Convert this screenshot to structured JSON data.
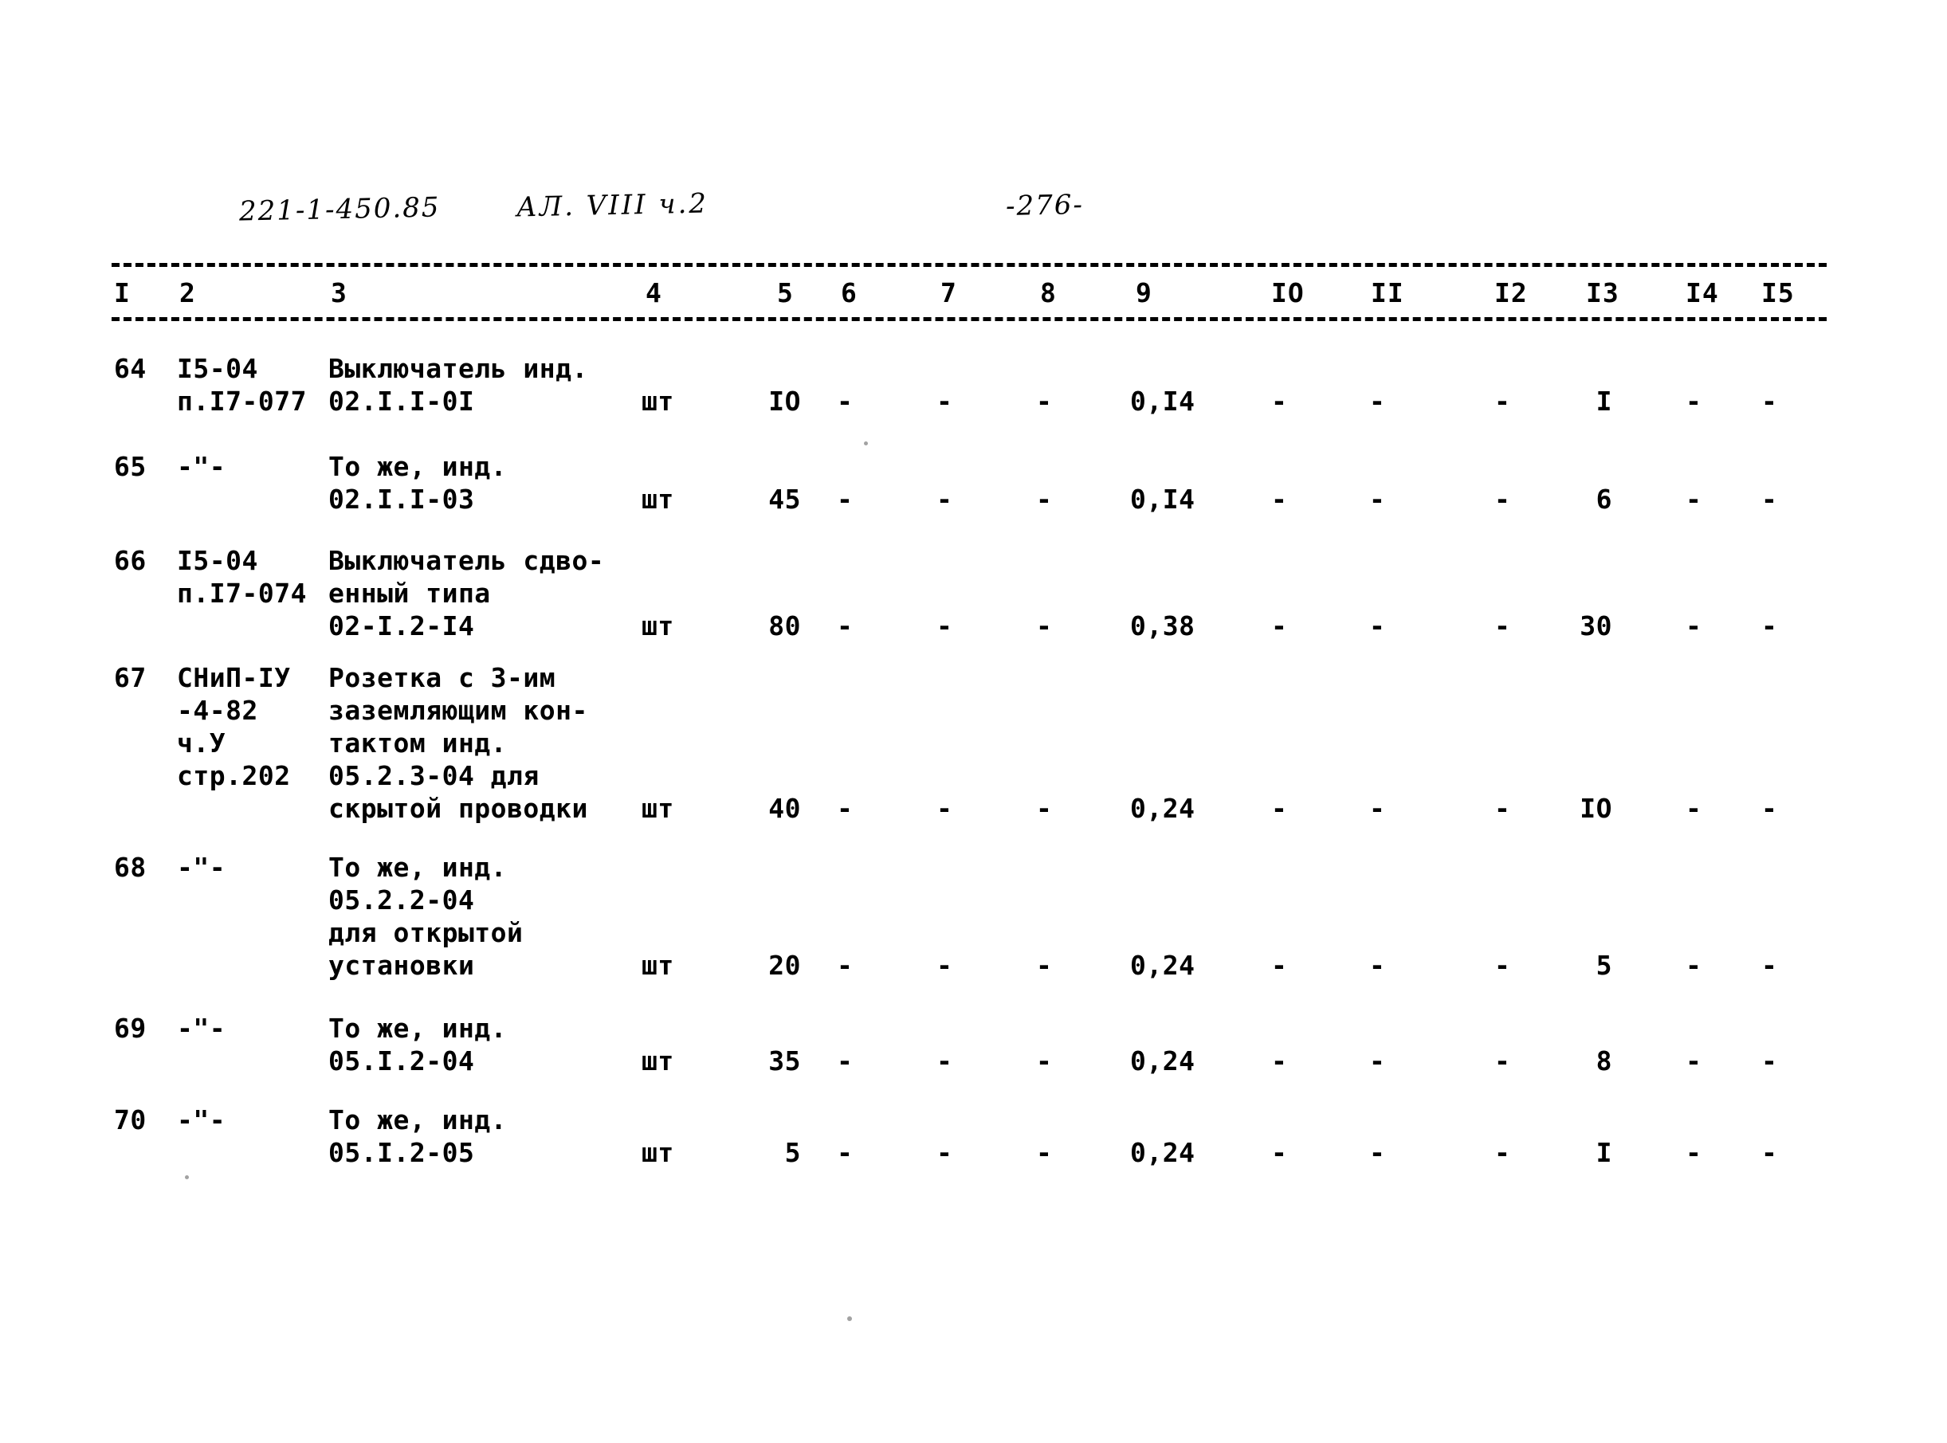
{
  "document": {
    "handwritten_code": "221-1-450.85",
    "handwritten_album": "АЛ. VIII ч.2",
    "page_number": "-276-"
  },
  "table": {
    "column_headers": [
      "I",
      "2",
      "3",
      "4",
      "5",
      "6",
      "7",
      "8",
      "9",
      "IO",
      "II",
      "I2",
      "I3",
      "I4",
      "I5"
    ],
    "rows": [
      {
        "num": "64",
        "code_lines": [
          "I5-04",
          "п.I7-077"
        ],
        "desc_lines": [
          "Выключатель инд.",
          "02.I.I-0I"
        ],
        "unit": "шт",
        "qty": "IO",
        "c6": "-",
        "c7": "-",
        "c8": "-",
        "c9": "0,I4",
        "c10": "-",
        "c11": "-",
        "c12": "-",
        "c13": "I",
        "c14": "-",
        "c15": "-"
      },
      {
        "num": "65",
        "code_lines": [
          "-\"-"
        ],
        "desc_lines": [
          "То же, инд.",
          "02.I.I-03"
        ],
        "unit": "шт",
        "qty": "45",
        "c6": "-",
        "c7": "-",
        "c8": "-",
        "c9": "0,I4",
        "c10": "-",
        "c11": "-",
        "c12": "-",
        "c13": "6",
        "c14": "-",
        "c15": "-"
      },
      {
        "num": "66",
        "code_lines": [
          "I5-04",
          "п.I7-074"
        ],
        "desc_lines": [
          "Выключатель сдво-",
          "енный типа",
          "02-I.2-I4"
        ],
        "unit": "шт",
        "qty": "80",
        "c6": "-",
        "c7": "-",
        "c8": "-",
        "c9": "0,38",
        "c10": "-",
        "c11": "-",
        "c12": "-",
        "c13": "30",
        "c14": "-",
        "c15": "-"
      },
      {
        "num": "67",
        "code_lines": [
          "СНиП-IУ",
          "-4-82",
          "ч.У",
          "стр.202"
        ],
        "desc_lines": [
          "Розетка с 3-им",
          "заземляющим кон-",
          "тактом инд.",
          "05.2.3-04 для",
          "скрытой проводки"
        ],
        "unit": "шт",
        "qty": "40",
        "c6": "-",
        "c7": "-",
        "c8": "-",
        "c9": "0,24",
        "c10": "-",
        "c11": "-",
        "c12": "-",
        "c13": "IO",
        "c14": "-",
        "c15": "-"
      },
      {
        "num": "68",
        "code_lines": [
          "-\"-"
        ],
        "desc_lines": [
          "То же, инд.",
          "05.2.2-04",
          "для открытой",
          "установки"
        ],
        "unit": "шт",
        "qty": "20",
        "c6": "-",
        "c7": "-",
        "c8": "-",
        "c9": "0,24",
        "c10": "-",
        "c11": "-",
        "c12": "-",
        "c13": "5",
        "c14": "-",
        "c15": "-"
      },
      {
        "num": "69",
        "code_lines": [
          "-\"-"
        ],
        "desc_lines": [
          "То же, инд.",
          "05.I.2-04"
        ],
        "unit": "шт",
        "qty": "35",
        "c6": "-",
        "c7": "-",
        "c8": "-",
        "c9": "0,24",
        "c10": "-",
        "c11": "-",
        "c12": "-",
        "c13": "8",
        "c14": "-",
        "c15": "-"
      },
      {
        "num": "70",
        "code_lines": [
          "-\"-"
        ],
        "desc_lines": [
          "То же, инд.",
          "05.I.2-05"
        ],
        "unit": "шт",
        "qty": "5",
        "c6": "-",
        "c7": "-",
        "c8": "-",
        "c9": "0,24",
        "c10": "-",
        "c11": "-",
        "c12": "-",
        "c13": "I",
        "c14": "-",
        "c15": "-"
      }
    ]
  }
}
